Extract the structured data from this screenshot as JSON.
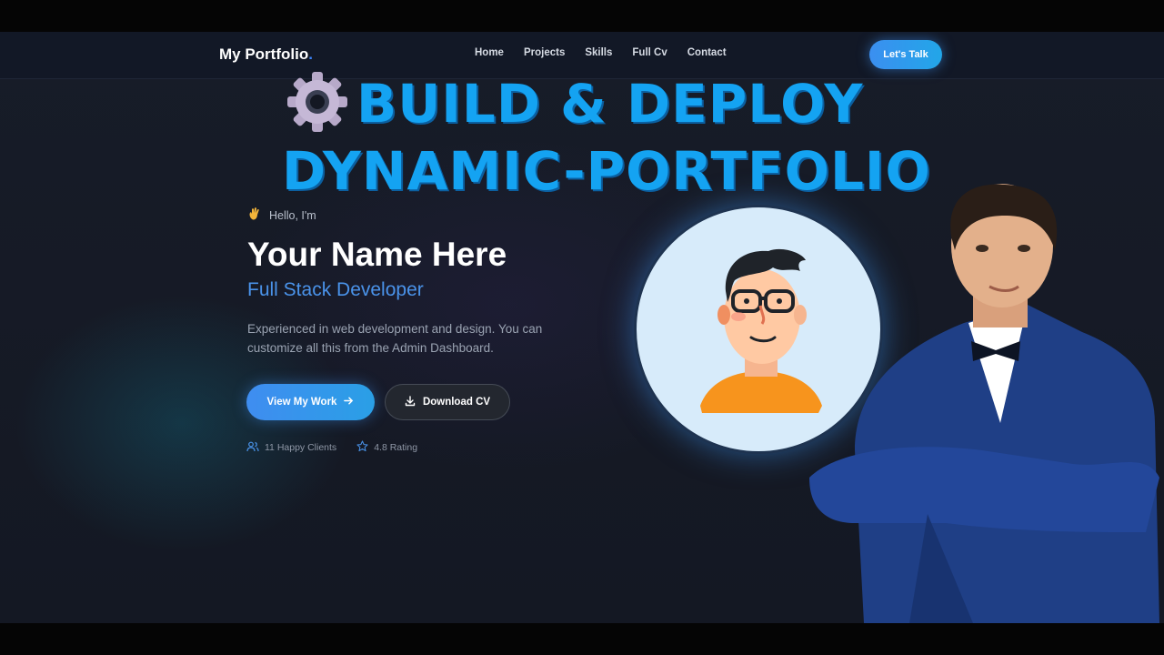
{
  "navbar": {
    "logo_text": "My Portfolio",
    "logo_dot": ".",
    "links": [
      "Home",
      "Projects",
      "Skills",
      "Full Cv",
      "Contact"
    ],
    "cta_label": "Let's Talk"
  },
  "overlay": {
    "line1": "BUILD & DEPLOY",
    "line2": "DYNAMIC-PORTFOLIO",
    "color": "#14a3f2",
    "icon": "gear-icon"
  },
  "hero": {
    "greeting_icon": "waving-hand-icon",
    "greeting": "Hello, I'm",
    "name": "Your Name Here",
    "role": "Full Stack Developer",
    "description": "Experienced in web development and design. You can customize all this from the Admin Dashboard.",
    "primary_button": {
      "label": "View My Work",
      "icon": "arrow-right-icon"
    },
    "secondary_button": {
      "label": "Download CV",
      "icon": "download-icon"
    },
    "stats": [
      {
        "icon": "users-icon",
        "text": "11 Happy Clients"
      },
      {
        "icon": "star-icon",
        "text": "4.8 Rating"
      }
    ]
  },
  "colors": {
    "accent": "#3b82f6",
    "background": "#161b26",
    "role_text": "#4a93ea"
  }
}
